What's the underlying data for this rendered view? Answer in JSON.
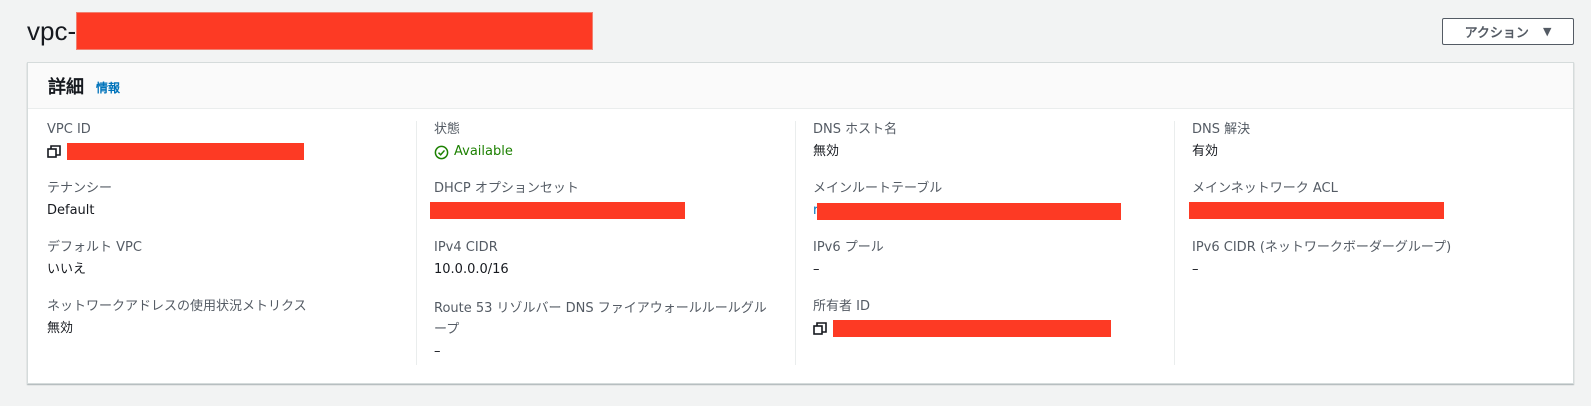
{
  "header": {
    "title_prefix": "vpc-",
    "action_label": "アクション",
    "action_caret": "▼"
  },
  "panel": {
    "title": "詳細",
    "info_link": "情報"
  },
  "fields": {
    "vpc_id": {
      "label": "VPC ID"
    },
    "tenancy": {
      "label": "テナンシー",
      "value": "Default"
    },
    "default_vpc": {
      "label": "デフォルト VPC",
      "value": "いいえ"
    },
    "network_address_metrics": {
      "label": "ネットワークアドレスの使用状況メトリクス",
      "value": "無効"
    },
    "state": {
      "label": "状態",
      "value": "Available"
    },
    "dhcp_options": {
      "label": "DHCP オプションセット"
    },
    "ipv4_cidr": {
      "label": "IPv4 CIDR",
      "value": "10.0.0.0/16"
    },
    "route53_firewall": {
      "label": "Route 53 リゾルバー DNS ファイアウォールルールグループ",
      "value": "–"
    },
    "dns_hostnames": {
      "label": "DNS ホスト名",
      "value": "無効"
    },
    "main_route_table": {
      "label": "メインルートテーブル",
      "value_prefix": "r"
    },
    "ipv6_pool": {
      "label": "IPv6 プール",
      "value": "–"
    },
    "owner_id": {
      "label": "所有者 ID"
    },
    "dns_resolution": {
      "label": "DNS 解決",
      "value": "有効"
    },
    "main_network_acl": {
      "label": "メインネットワーク ACL"
    },
    "ipv6_cidr_border": {
      "label": "IPv6 CIDR (ネットワークボーダーグループ)",
      "value": "–"
    }
  },
  "colors": {
    "accent_link": "#0073bb",
    "status_green": "#1d8102",
    "redaction": "#fd3a24"
  },
  "icons": [
    "copy-icon",
    "check-circle-icon",
    "caret-down-icon"
  ]
}
